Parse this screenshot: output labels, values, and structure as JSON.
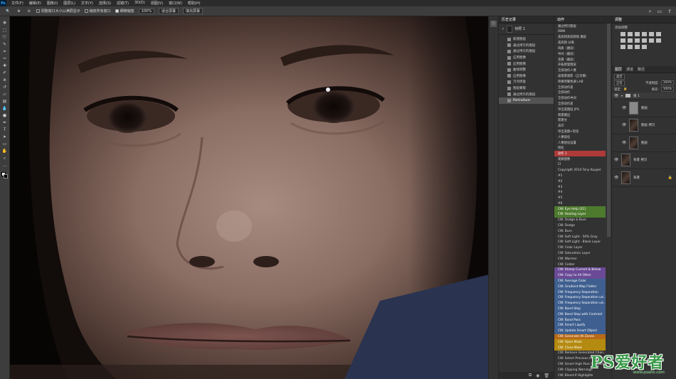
{
  "app": {
    "logo": "Ps"
  },
  "menu": [
    "文件(F)",
    "编辑(E)",
    "图像(I)",
    "图层(L)",
    "文字(Y)",
    "选择(S)",
    "滤镜(T)",
    "3D(D)",
    "视图(V)",
    "窗口(W)",
    "帮助(H)"
  ],
  "options": {
    "resize_windows": "调整窗口大小以满屏显示",
    "zoom_all": "缩放所有窗口",
    "scrubby_zoom": "细微缩放",
    "zoom_value": "100%",
    "fit_screen": "适合屏幕",
    "fill_screen": "填充屏幕"
  },
  "history": {
    "title": "历史记录",
    "snapshot": "快照 1",
    "items": [
      "新建图层",
      "通过拷贝的图层",
      "通过拷贝的图层",
      "应用图像",
      "应用图像",
      "曲线调整",
      "应用图像",
      "污点修复",
      "图层蒙版",
      "通过拷贝的图层",
      "Portraiture"
    ],
    "selected_index": 10
  },
  "actions": {
    "title": "动作",
    "items": [
      {
        "label": "通过拷贝图层",
        "color": ""
      },
      {
        "label": "DBW",
        "color": ""
      },
      {
        "label": "盖高频高低频保 磨皮",
        "color": ""
      },
      {
        "label": "盖高频 分离",
        "color": ""
      },
      {
        "label": "肉质（磨皮）",
        "color": ""
      },
      {
        "label": "中间（磨皮）",
        "color": ""
      },
      {
        "label": "金属（磨皮）",
        "color": ""
      },
      {
        "label": "开拓修复图层",
        "color": ""
      },
      {
        "label": "全部动作人像",
        "color": ""
      },
      {
        "label": "滤镜景观影（正肖像）",
        "color": ""
      },
      {
        "label": "转换到暖色调 LAB",
        "color": ""
      },
      {
        "label": "全部动作盖",
        "color": ""
      },
      {
        "label": "全部动作",
        "color": ""
      },
      {
        "label": "全部动作中间",
        "color": ""
      },
      {
        "label": "全部动作盖",
        "color": ""
      },
      {
        "label": "导出盖图层 JPG",
        "color": ""
      },
      {
        "label": "新建输出",
        "color": ""
      },
      {
        "label": "新建文",
        "color": ""
      },
      {
        "label": "去印",
        "color": ""
      },
      {
        "label": "导出盖图+锐化",
        "color": ""
      },
      {
        "label": "人像锐化",
        "color": ""
      },
      {
        "label": "人像锐化设置",
        "color": ""
      },
      {
        "label": "锐化",
        "color": ""
      },
      {
        "label": "动作 1",
        "color": "#b03a3a"
      },
      {
        "label": "观察图像",
        "color": ""
      },
      {
        "label": "CI",
        "color": ""
      },
      {
        "label": "Copyright 2014 Tony Kuyper",
        "color": ""
      },
      {
        "label": "#1",
        "color": ""
      },
      {
        "label": "#2",
        "color": ""
      },
      {
        "label": "#3",
        "color": ""
      },
      {
        "label": "#4",
        "color": ""
      },
      {
        "label": "#5",
        "color": ""
      },
      {
        "label": "#6",
        "color": ""
      },
      {
        "label": "CW: Eye Help (2C)",
        "color": "#4d7a2d"
      },
      {
        "label": "CW: Healing Layer",
        "color": "#4d7a2d"
      },
      {
        "label": "CW: Dodge & Burn",
        "color": ""
      },
      {
        "label": "CW: Dodge",
        "color": ""
      },
      {
        "label": "CW: Burn",
        "color": ""
      },
      {
        "label": "CW: Soft Light - 50% Gray",
        "color": ""
      },
      {
        "label": "CW: Soft Light - Blank Layer",
        "color": ""
      },
      {
        "label": "CW: Color Layer",
        "color": ""
      },
      {
        "label": "CW: Saturation Layer",
        "color": ""
      },
      {
        "label": "CW: Warmer",
        "color": ""
      },
      {
        "label": "CW: Colder",
        "color": ""
      },
      {
        "label": "CW: Stamp Current & Below",
        "color": "#6a4a96"
      },
      {
        "label": "CW: Copy to All Other",
        "color": "#6a4a96"
      },
      {
        "label": "CW: Average Color",
        "color": "#3e5f8f"
      },
      {
        "label": "CW: Gradient Map Flatter",
        "color": "#3e5f8f"
      },
      {
        "label": "CW: Frequency Separation",
        "color": "#3e5f8f"
      },
      {
        "label": "CW: Frequency Separation usi...",
        "color": "#3e5f8f"
      },
      {
        "label": "CW: Frequency Separation usi...",
        "color": "#3e5f8f"
      },
      {
        "label": "CW: Band Stop",
        "color": "#3e5f8f"
      },
      {
        "label": "CW: Band Stop with Contrast",
        "color": "#3e5f8f"
      },
      {
        "label": "CW: Band Pass",
        "color": "#3e5f8f"
      },
      {
        "label": "CW: Smart Liquify",
        "color": "#3e5f8f"
      },
      {
        "label": "CW: Update Smart Object",
        "color": "#3e5f8f"
      },
      {
        "label": "CW: Generate All Zones",
        "color": "#b86a16"
      },
      {
        "label": "CW: Open Mask",
        "color": "#b58a10"
      },
      {
        "label": "CW: Close Mask",
        "color": "#b58a10"
      },
      {
        "label": "CW: Remove Generated Chan...",
        "color": ""
      },
      {
        "label": "CW: Select Previous Layer",
        "color": ""
      },
      {
        "label": "CW: Smart High Pass Sharpen",
        "color": ""
      },
      {
        "label": "CW: Clipping Warnings",
        "color": ""
      },
      {
        "label": "CW: Blend-If Highlights",
        "color": ""
      }
    ]
  },
  "adjustments": {
    "title": "调整",
    "subtitle": "添加调整"
  },
  "layers": {
    "tabs": [
      "图层",
      "通道",
      "路径"
    ],
    "kind": "类型",
    "blend": "正常",
    "opacity_label": "不透明度:",
    "opacity": "100%",
    "lock_label": "锁定:",
    "fill_label": "填充:",
    "fill": "100%",
    "group": "组 1",
    "items": [
      {
        "name": "图层",
        "thumb": "gray",
        "indent": true
      },
      {
        "name": "图层 拷贝",
        "thumb": "photo",
        "indent": true
      },
      {
        "name": "图层",
        "thumb": "photo",
        "indent": true
      },
      {
        "name": "背景 拷贝",
        "thumb": "photo",
        "indent": false
      },
      {
        "name": "背景",
        "thumb": "photo",
        "indent": false,
        "locked": true
      }
    ]
  },
  "watermark": {
    "main": "PS爱好者",
    "sub": "www.psahz.com"
  }
}
